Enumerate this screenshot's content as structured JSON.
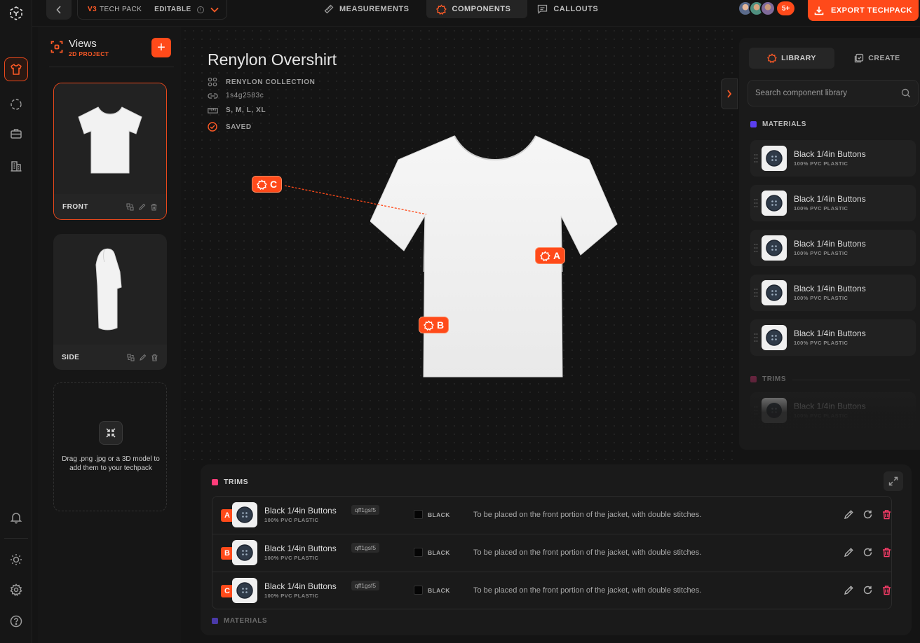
{
  "topbar": {
    "version": "V3",
    "pack_label": "TECH PACK",
    "mode": "EDITABLE",
    "tabs": [
      {
        "label": "MEASUREMENTS",
        "icon": "ruler-icon"
      },
      {
        "label": "COMPONENTS",
        "icon": "component-icon"
      },
      {
        "label": "CALLOUTS",
        "icon": "comment-icon"
      }
    ],
    "collaborators_more": "5+",
    "export_label": "EXPORT TECHPACK"
  },
  "sidebar": {
    "icons": [
      "logo-icon",
      "shirt-icon",
      "circle-dashed-icon",
      "briefcase-icon",
      "building-icon",
      "bell-icon",
      "sun-icon",
      "gear-icon",
      "help-icon"
    ]
  },
  "views": {
    "title": "Views",
    "subtitle": "2D PROJECT",
    "add_label": "+",
    "items": [
      {
        "label": "FRONT"
      },
      {
        "label": "SIDE"
      }
    ],
    "drop_text": "Drag .png .jpg or a 3D model to add them to your techpack"
  },
  "product": {
    "title": "Renylon Overshirt",
    "collection": "RENYLON COLLECTION",
    "id": "1s4g2583c",
    "sizes": "S, M, L, XL",
    "status": "SAVED"
  },
  "callouts": [
    "C",
    "A",
    "B"
  ],
  "library": {
    "tabs": [
      {
        "label": "LIBRARY"
      },
      {
        "label": "CREATE"
      }
    ],
    "search_placeholder": "Search component library",
    "materials_label": "MATERIALS",
    "trims_label": "TRIMS",
    "items": [
      {
        "name": "Black 1/4in Buttons",
        "sub": "100% PVC PLASTIC"
      },
      {
        "name": "Black 1/4in Buttons",
        "sub": "100% PVC PLASTIC"
      },
      {
        "name": "Black 1/4in Buttons",
        "sub": "100% PVC PLASTIC"
      },
      {
        "name": "Black 1/4in Buttons",
        "sub": "100% PVC PLASTIC"
      },
      {
        "name": "Black 1/4in Buttons",
        "sub": "100% PVC PLASTIC"
      }
    ],
    "trim_item": {
      "name": "Black 1/4in Buttons",
      "sub": "100% PVC PLASTIC"
    }
  },
  "trims": {
    "label": "TRIMS",
    "materials_label": "MATERIALS",
    "rows": [
      {
        "badge": "A",
        "name": "Black 1/4in Buttons",
        "sub": "100% PVC PLASTIC",
        "code": "qff1gsf5",
        "color": "BLACK",
        "note": "To be placed on the front portion of the jacket, with double stitches."
      },
      {
        "badge": "B",
        "name": "Black 1/4in Buttons",
        "sub": "100% PVC PLASTIC",
        "code": "qff1gsf5",
        "color": "BLACK",
        "note": "To be placed on the front portion of the jacket, with double stitches."
      },
      {
        "badge": "C",
        "name": "Black 1/4in Buttons",
        "sub": "100% PVC PLASTIC",
        "code": "qff1gsf5",
        "color": "BLACK",
        "note": "To be placed on the front portion of the jacket, with double stitches."
      }
    ]
  },
  "colors": {
    "accent": "#ff4a1a",
    "background": "#141414",
    "trims_marker": "#ff3d7a",
    "materials_marker": "#5b3ff0"
  }
}
